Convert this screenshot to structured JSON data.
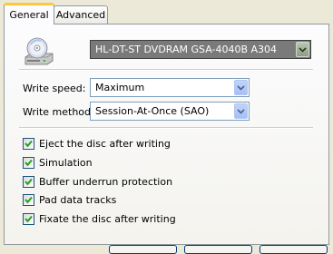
{
  "tabs": [
    {
      "label": "General",
      "active": true
    },
    {
      "label": "Advanced",
      "active": false
    }
  ],
  "drive": {
    "icon": "cd-drive-icon",
    "selected": "HL-DT-ST DVDRAM GSA-4040B A304"
  },
  "write_speed": {
    "label": "Write speed:",
    "value": "Maximum"
  },
  "write_method": {
    "label": "Write method:",
    "value": "Session-At-Once (SAO)"
  },
  "options": [
    {
      "label": "Eject the disc after writing",
      "checked": true
    },
    {
      "label": "Simulation",
      "checked": true
    },
    {
      "label": "Buffer underrun protection",
      "checked": true
    },
    {
      "label": "Pad data tracks",
      "checked": true
    },
    {
      "label": "Fixate the disc after writing",
      "checked": true
    }
  ],
  "colors": {
    "check": "#21a121",
    "accent_tab": "#ffc83c",
    "selection": "#316ac5"
  }
}
